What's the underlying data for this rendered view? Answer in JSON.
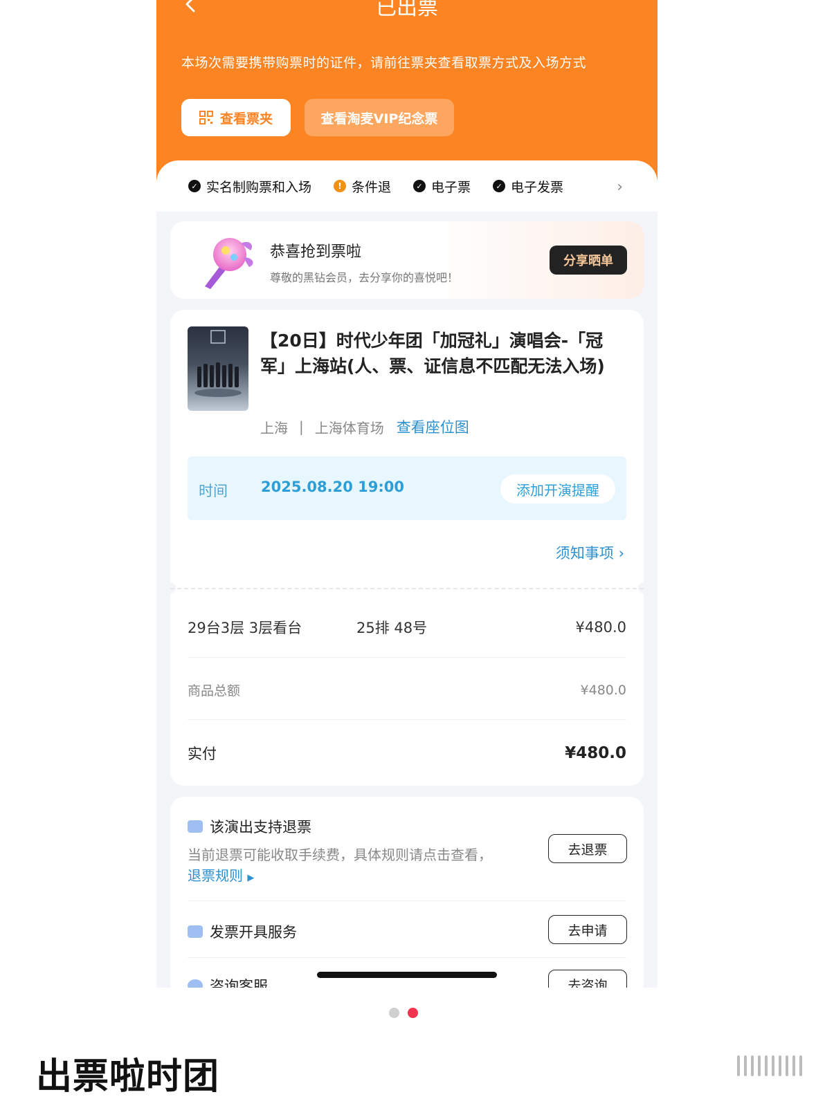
{
  "header": {
    "title": "已出票",
    "notice": "本场次需要携带购票时的证件，请前往票夹查看取票方式及入场方式",
    "wallet_button": "查看票夹",
    "vip_button": "查看淘麦VIP纪念票",
    "accent_color": "#fd8422"
  },
  "features": [
    "实名制购票和入场",
    "条件退",
    "电子票",
    "电子发票"
  ],
  "congrats": {
    "title": "恭喜抢到票啦",
    "subtitle": "尊敬的黑钻会员，去分享你的喜悦吧！",
    "share_button": "分享晒单"
  },
  "event": {
    "title": "【20日】时代少年团「加冠礼」演唱会-「冠军」上海站(人、票、证信息不匹配无法入场)",
    "city": "上海",
    "separator": "|",
    "venue": "上海体育场",
    "seat_map_link": "查看座位图",
    "time_label": "时间",
    "time_value": "2025.08.20 19:00",
    "reminder_button": "添加开演提醒",
    "notes_link": "须知事项"
  },
  "order": {
    "seat_area": "29台3层 3层看台",
    "seat_row": "25排 48号",
    "seat_price": "¥480.0",
    "total_label": "商品总额",
    "total_value": "¥480.0",
    "paid_label": "实付",
    "paid_value": "¥480.0"
  },
  "services": {
    "refund_title": "该演出支持退票",
    "refund_desc": "当前退票可能收取手续费，具体规则请点击查看，",
    "refund_rules_link": "退票规则",
    "refund_button": "去退票",
    "invoice_title": "发票开具服务",
    "invoice_button": "去申请",
    "support_title": "咨询客服",
    "support_button": "去咨询"
  },
  "pager": {
    "total": 2,
    "active": 2
  },
  "caption": "出票啦时团"
}
